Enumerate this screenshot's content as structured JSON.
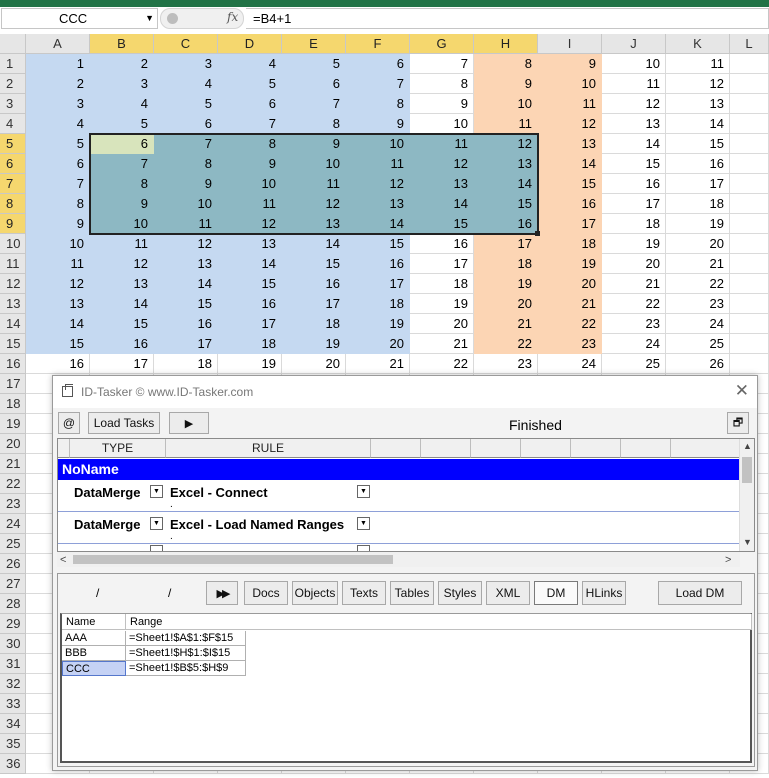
{
  "formula_bar": {
    "name_box": "CCC",
    "fx_label": "fx",
    "formula": "=B4+1"
  },
  "sheet": {
    "columns": [
      "A",
      "B",
      "C",
      "D",
      "E",
      "F",
      "G",
      "H",
      "I",
      "J",
      "K",
      "L"
    ],
    "rows": [
      "1",
      "2",
      "3",
      "4",
      "5",
      "6",
      "7",
      "8",
      "9",
      "10",
      "11",
      "12",
      "13",
      "14",
      "15",
      "16",
      "17",
      "18",
      "19",
      "20",
      "21",
      "22",
      "23",
      "24",
      "25",
      "26",
      "27",
      "28",
      "29",
      "30",
      "31",
      "32",
      "33",
      "34",
      "35",
      "36"
    ],
    "selected_columns": [
      "B",
      "C",
      "D",
      "E",
      "F",
      "G",
      "H"
    ],
    "selected_rows": [
      "5",
      "6",
      "7",
      "8",
      "9"
    ],
    "active_cell": "B5",
    "values": [
      [
        "1",
        "2",
        "3",
        "4",
        "5",
        "6",
        "7",
        "8",
        "9",
        "10",
        "11"
      ],
      [
        "2",
        "3",
        "4",
        "5",
        "6",
        "7",
        "8",
        "9",
        "10",
        "11",
        "12"
      ],
      [
        "3",
        "4",
        "5",
        "6",
        "7",
        "8",
        "9",
        "10",
        "11",
        "12",
        "13"
      ],
      [
        "4",
        "5",
        "6",
        "7",
        "8",
        "9",
        "10",
        "11",
        "12",
        "13",
        "14"
      ],
      [
        "5",
        "6",
        "7",
        "8",
        "9",
        "10",
        "11",
        "12",
        "13",
        "14",
        "15"
      ],
      [
        "6",
        "7",
        "8",
        "9",
        "10",
        "11",
        "12",
        "13",
        "14",
        "15",
        "16"
      ],
      [
        "7",
        "8",
        "9",
        "10",
        "11",
        "12",
        "13",
        "14",
        "15",
        "16",
        "17"
      ],
      [
        "8",
        "9",
        "10",
        "11",
        "12",
        "13",
        "14",
        "15",
        "16",
        "17",
        "18"
      ],
      [
        "9",
        "10",
        "11",
        "12",
        "13",
        "14",
        "15",
        "16",
        "17",
        "18",
        "19"
      ],
      [
        "10",
        "11",
        "12",
        "13",
        "14",
        "15",
        "16",
        "17",
        "18",
        "19",
        "20"
      ],
      [
        "11",
        "12",
        "13",
        "14",
        "15",
        "16",
        "17",
        "18",
        "19",
        "20",
        "21"
      ],
      [
        "12",
        "13",
        "14",
        "15",
        "16",
        "17",
        "18",
        "19",
        "20",
        "21",
        "22"
      ],
      [
        "13",
        "14",
        "15",
        "16",
        "17",
        "18",
        "19",
        "20",
        "21",
        "22",
        "23"
      ],
      [
        "14",
        "15",
        "16",
        "17",
        "18",
        "19",
        "20",
        "21",
        "22",
        "23",
        "24"
      ],
      [
        "15",
        "16",
        "17",
        "18",
        "19",
        "20",
        "21",
        "22",
        "23",
        "24",
        "25"
      ],
      [
        "16",
        "17",
        "18",
        "19",
        "20",
        "21",
        "22",
        "23",
        "24",
        "25",
        "26"
      ]
    ],
    "named_range_colors": {
      "AAA": "#c5d9f1",
      "BBB": "#fcd5b4",
      "CCC": "#8db8c3",
      "active": "#d8e4bc",
      "selected_header": "#f5d76e"
    }
  },
  "tasker": {
    "title": "ID-Tasker  © www.ID-Tasker.com",
    "at_button": "@",
    "load_tasks_button": "Load Tasks",
    "play_icon": "play-icon",
    "status": "Finished",
    "restore_icon": "restore-icon",
    "table": {
      "headers": [
        "TYPE",
        "RULE"
      ],
      "group_name": "NoName",
      "rows": [
        {
          "type": "DataMerge",
          "rule": "Excel - Connect",
          "sub": "."
        },
        {
          "type": "DataMerge",
          "rule": "Excel - Load Named Ranges",
          "sub": "."
        }
      ]
    },
    "toolbar": {
      "slash_1": "/",
      "slash_2": "/",
      "forward_icon": "fast-forward-icon",
      "tabs": [
        "Docs",
        "Objects",
        "Texts",
        "Tables",
        "Styles",
        "XML",
        "DM",
        "HLinks"
      ],
      "active_tab": "DM",
      "load_dm_button": "Load DM"
    },
    "dm": {
      "headers": [
        "Name",
        "Range"
      ],
      "rows": [
        {
          "name": "AAA",
          "range": "=Sheet1!$A$1:$F$15"
        },
        {
          "name": "BBB",
          "range": "=Sheet1!$H$1:$I$15"
        },
        {
          "name": "CCC",
          "range": "=Sheet1!$B$5:$H$9"
        }
      ],
      "selected": "CCC"
    }
  }
}
